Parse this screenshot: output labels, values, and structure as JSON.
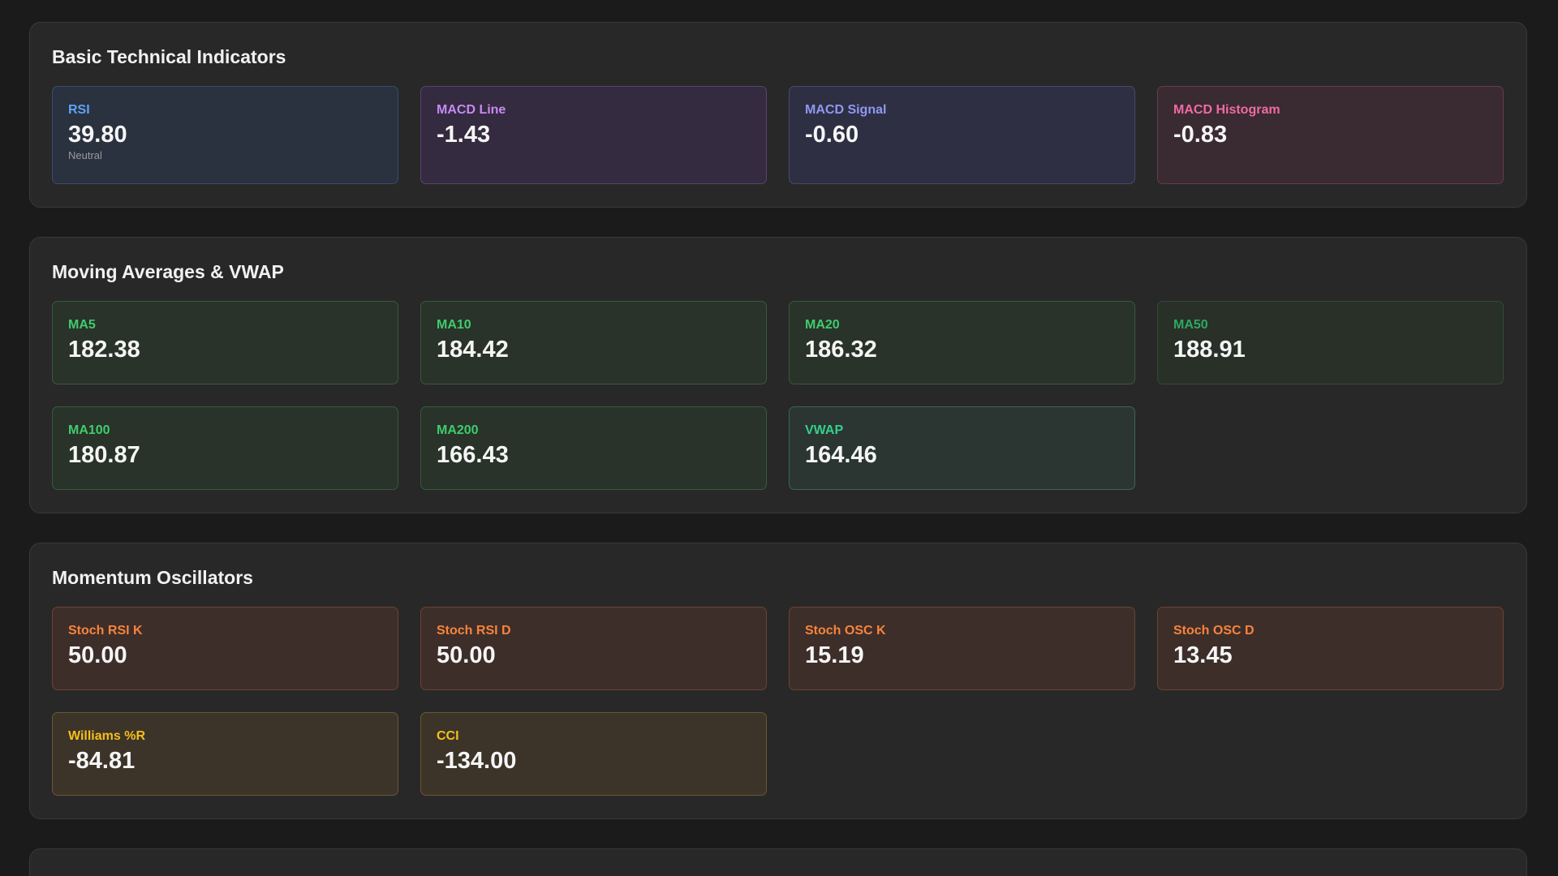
{
  "sections": {
    "basic": {
      "title": "Basic Technical Indicators",
      "cards": [
        {
          "label": "RSI",
          "value": "39.80",
          "sub": "Neutral"
        },
        {
          "label": "MACD Line",
          "value": "-1.43"
        },
        {
          "label": "MACD Signal",
          "value": "-0.60"
        },
        {
          "label": "MACD Histogram",
          "value": "-0.83"
        }
      ]
    },
    "moving_averages": {
      "title": "Moving Averages & VWAP",
      "cards": [
        {
          "label": "MA5",
          "value": "182.38"
        },
        {
          "label": "MA10",
          "value": "184.42"
        },
        {
          "label": "MA20",
          "value": "186.32"
        },
        {
          "label": "MA50",
          "value": "188.91"
        },
        {
          "label": "MA100",
          "value": "180.87"
        },
        {
          "label": "MA200",
          "value": "166.43"
        },
        {
          "label": "VWAP",
          "value": "164.46"
        }
      ]
    },
    "momentum": {
      "title": "Momentum Oscillators",
      "cards": [
        {
          "label": "Stoch RSI K",
          "value": "50.00"
        },
        {
          "label": "Stoch RSI D",
          "value": "50.00"
        },
        {
          "label": "Stoch OSC K",
          "value": "15.19"
        },
        {
          "label": "Stoch OSC D",
          "value": "13.45"
        },
        {
          "label": "Williams %R",
          "value": "-84.81"
        },
        {
          "label": "CCI",
          "value": "-134.00"
        }
      ]
    }
  },
  "colors": {
    "background": "#1b1b1b",
    "panel": "#282828",
    "rsi_label": "#5ea3f5",
    "macd_line_label": "#c58af4",
    "macd_signal_label": "#8f98f3",
    "macd_histogram_label": "#f06aa6",
    "ma_label": "#3fcc6d",
    "vwap_label": "#35d08a",
    "stoch_label": "#f7843a",
    "williams_cci_label": "#f5bf1c"
  }
}
